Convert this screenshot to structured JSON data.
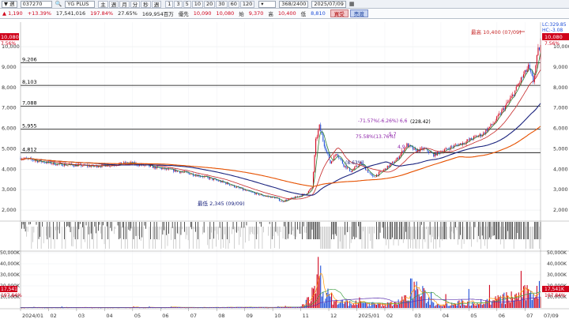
{
  "toolbar": {
    "period_label": "▼ 週",
    "code": "037270",
    "name": "YG PLUS",
    "buttons": [
      "主",
      "週",
      "月",
      "分",
      "秒",
      "週"
    ],
    "intervals": [
      "1",
      "3",
      "5",
      "10",
      "20",
      "30",
      "60",
      "120"
    ],
    "count": "368/2400",
    "date": "2025/07/09"
  },
  "infobar": {
    "price_change": "▲ 1,190",
    "change_pct": "+13.39%",
    "volume": "17,541,016",
    "vol_ratio": "197.84%",
    "turnover_pct": "27.65%",
    "amount": "169,954百万",
    "label_pref": "優先",
    "pref": "10,090",
    "v2": "10,080",
    "open_label": "始",
    "open": "9,370",
    "high_label": "高",
    "high": "10,400",
    "low_label": "低",
    "low": "8,810",
    "buy": "買受",
    "sell": "売渡"
  },
  "annotations": {
    "high_label": "最高 10,400 (07/09)",
    "low_label": "最低 2,345 (09/09)",
    "fib1": "-71.57%(-6.26%) 6,6",
    "fib2": "(228.42)",
    "fib3": "75.58%(13.76%)",
    "fib4": "5,7",
    "fib5": "4,9",
    "fib6": "(8.63%)",
    "right_lc": "LC:329.85",
    "right_hc": "HC:-3.08",
    "right_price": "10,080",
    "right_pct": "7.56%",
    "left_price": "10,080",
    "left_pct": "7.56%",
    "vol_left_label": "17,541K",
    "vol_left_pct": "197.84%",
    "vol_right_label": "17,541K",
    "vol_right_pct": "197.84%"
  },
  "colors": {
    "up": "#d0021b",
    "down": "#1d4ed8",
    "ma_short": "#2e7d32",
    "ma_mid": "#c62828",
    "ma_long": "#1a237e",
    "ma_xlong": "#e65100",
    "hline": "#000000"
  },
  "chart_data": {
    "type": "candlestick",
    "y_axis": {
      "min": 1500,
      "max": 11200,
      "ticks": [
        2000,
        3000,
        4000,
        5000,
        6000,
        7000,
        8000,
        9000,
        10000
      ],
      "tick_labels": [
        "2,000",
        "3,000",
        "4,000",
        "5,000",
        "6,000",
        "7,000",
        "8,000",
        "9,000",
        "10,000"
      ]
    },
    "horizontal_lines": [
      {
        "value": 9206,
        "label": "9,206"
      },
      {
        "value": 8103,
        "label": "8,103"
      },
      {
        "value": 7088,
        "label": "7,088"
      },
      {
        "value": 5955,
        "label": "5,955"
      },
      {
        "value": 4812,
        "label": "4,812"
      }
    ],
    "x_ticks": [
      "2024/01",
      "02",
      "03",
      "04",
      "05",
      "06",
      "07",
      "08",
      "09",
      "10",
      "11",
      "12",
      "2025/01",
      "02",
      "03",
      "04",
      "05",
      "06",
      "07"
    ],
    "bottom_right_date": "07/09",
    "anchors": [
      [
        0,
        4550
      ],
      [
        30,
        4250
      ],
      [
        60,
        4150
      ],
      [
        90,
        4300
      ],
      [
        110,
        4100
      ],
      [
        130,
        3900
      ],
      [
        150,
        3650
      ],
      [
        170,
        3300
      ],
      [
        185,
        2950
      ],
      [
        200,
        2700
      ],
      [
        210,
        2600
      ],
      [
        215,
        2420
      ],
      [
        225,
        2600
      ],
      [
        235,
        2800
      ],
      [
        240,
        3100
      ],
      [
        243,
        5400
      ],
      [
        246,
        6100
      ],
      [
        250,
        5200
      ],
      [
        255,
        4300
      ],
      [
        260,
        4800
      ],
      [
        266,
        4200
      ],
      [
        272,
        3900
      ],
      [
        280,
        4300
      ],
      [
        290,
        3600
      ],
      [
        300,
        4000
      ],
      [
        310,
        4500
      ],
      [
        318,
        5200
      ],
      [
        325,
        4900
      ],
      [
        332,
        5000
      ],
      [
        340,
        4700
      ],
      [
        348,
        4900
      ],
      [
        355,
        5100
      ],
      [
        365,
        5300
      ],
      [
        375,
        5600
      ],
      [
        380,
        5700
      ],
      [
        390,
        6300
      ],
      [
        398,
        7000
      ],
      [
        405,
        7600
      ],
      [
        412,
        8400
      ],
      [
        418,
        9000
      ],
      [
        422,
        8300
      ],
      [
        426,
        9800
      ],
      [
        428,
        10080
      ]
    ],
    "candle_count": 429,
    "ma_periods": [
      5,
      20,
      60,
      120
    ],
    "volume_axis": {
      "max": 50000,
      "ticks": [
        10000,
        20000,
        30000,
        40000,
        50000
      ],
      "tick_labels": [
        "10,000K",
        "20,000K",
        "30,000K",
        "40,000K",
        "50,000K"
      ]
    },
    "volume_anchors": [
      [
        0,
        400
      ],
      [
        230,
        600
      ],
      [
        243,
        17000
      ],
      [
        246,
        40000
      ],
      [
        250,
        15000
      ],
      [
        260,
        6000
      ],
      [
        300,
        3000
      ],
      [
        318,
        9000
      ],
      [
        322,
        23000
      ],
      [
        340,
        4000
      ],
      [
        380,
        6000
      ],
      [
        410,
        12000
      ],
      [
        425,
        17541
      ],
      [
        428,
        17541
      ]
    ]
  }
}
